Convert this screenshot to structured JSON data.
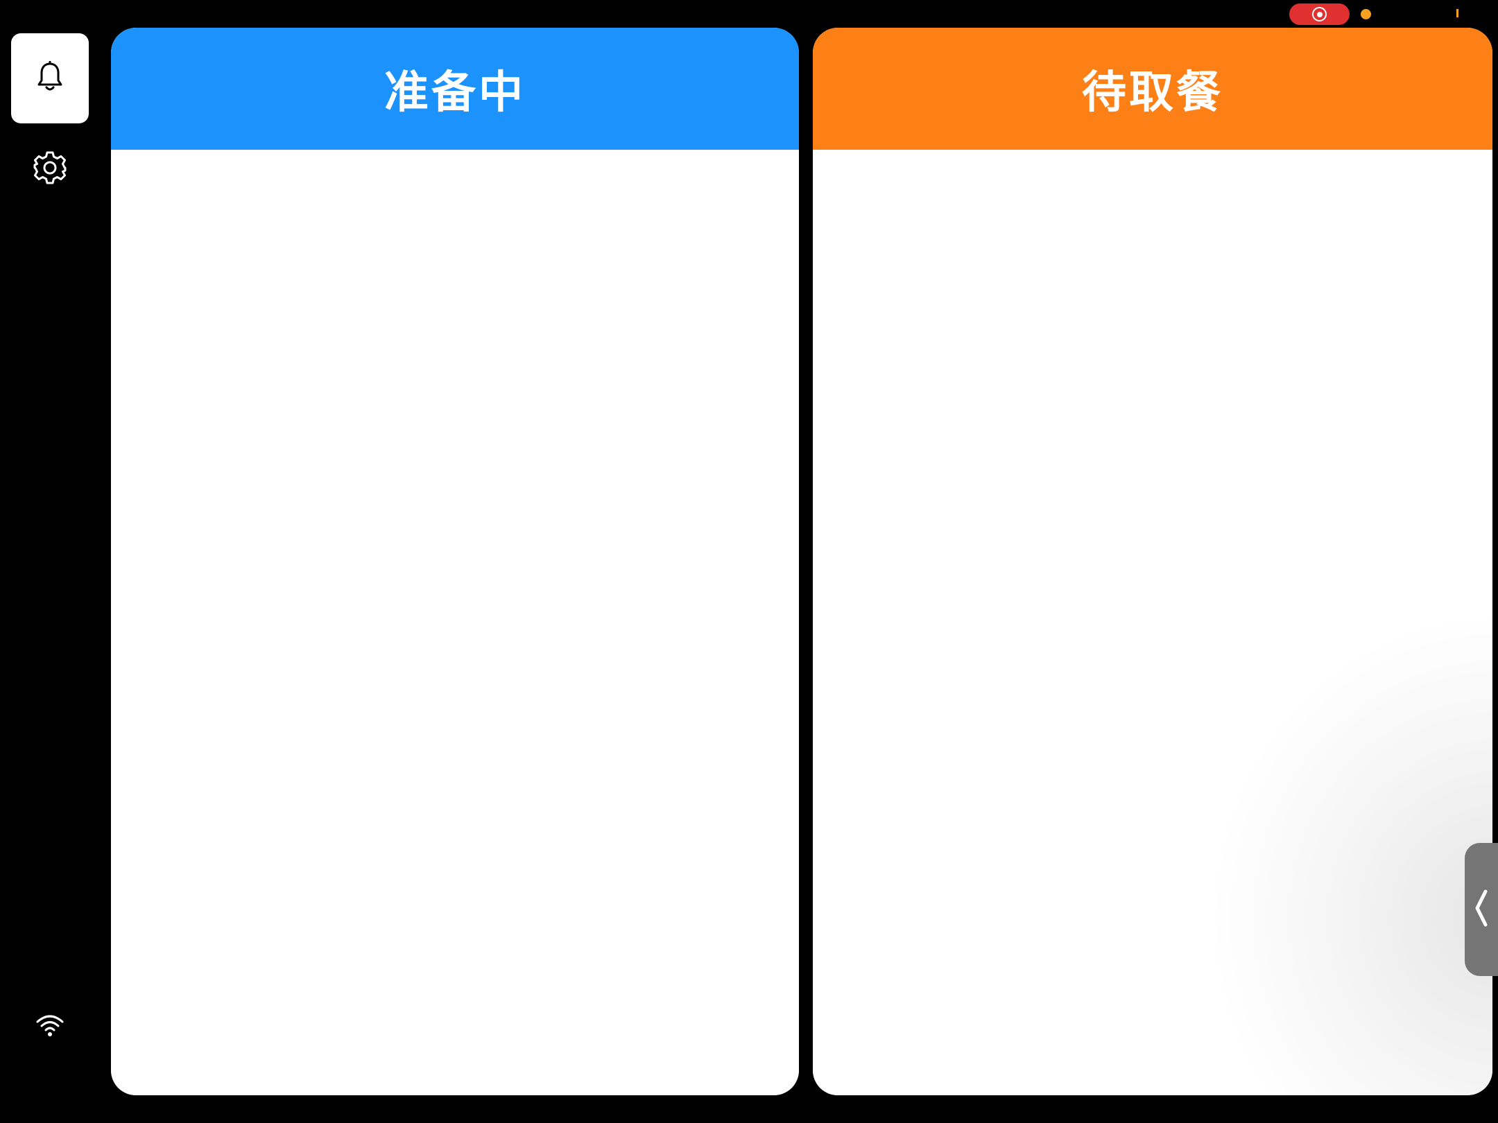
{
  "status_bar": {
    "recording_icon": "record-icon",
    "mic_indicator_color": "#f7a022",
    "recording_color": "#e0302f"
  },
  "sidebar": {
    "items": [
      {
        "icon": "bell-icon",
        "selected": true
      },
      {
        "icon": "gear-icon",
        "selected": false
      }
    ],
    "footer_icon": "wifi-icon"
  },
  "panels": {
    "preparing": {
      "title": "准备中",
      "color": "#1b92fc",
      "orders": []
    },
    "ready": {
      "title": "待取餐",
      "color": "#fd8016",
      "orders": []
    }
  },
  "side_tab": {
    "icon": "chevron-left-icon"
  }
}
